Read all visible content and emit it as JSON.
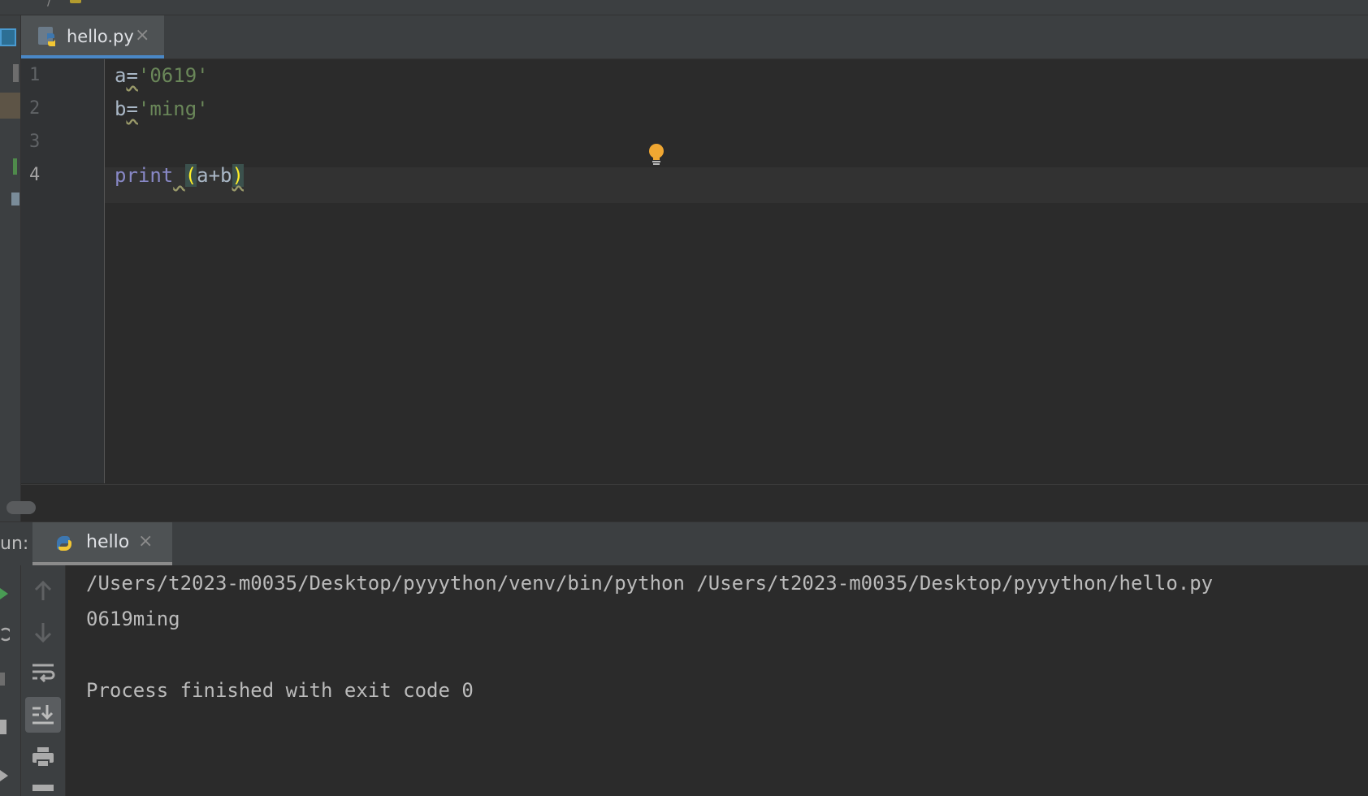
{
  "editor": {
    "tab": {
      "filename": "hello.py",
      "close_glyph": "×"
    },
    "lines": [
      {
        "number": "1",
        "var": "a",
        "op": "=",
        "value": "'0619'"
      },
      {
        "number": "2",
        "var": "b",
        "op": "=",
        "value": "'ming'"
      },
      {
        "number": "3"
      },
      {
        "number": "4",
        "keyword": "print",
        "space": " ",
        "open": "(",
        "args": "a+b",
        "close": ")"
      }
    ],
    "intention_icon": "lightbulb-icon"
  },
  "run": {
    "label": "un:",
    "tab": {
      "name": "hello",
      "close_glyph": "×"
    },
    "toolbar_icons": [
      "up-arrow-icon",
      "down-arrow-icon",
      "soft-wrap-icon",
      "scroll-to-end-icon",
      "print-icon"
    ],
    "console": [
      "/Users/t2023-m0035/Desktop/pyyython/venv/bin/python /Users/t2023-m0035/Desktop/pyyython/hello.py",
      "0619ming",
      "",
      "Process finished with exit code 0"
    ]
  },
  "colors": {
    "background": "#2b2b2b",
    "panel": "#3c3f41",
    "string": "#6a8759",
    "keyword": "#8888c6",
    "tab_accent": "#4a88c7",
    "bulb": "#f0a732"
  }
}
